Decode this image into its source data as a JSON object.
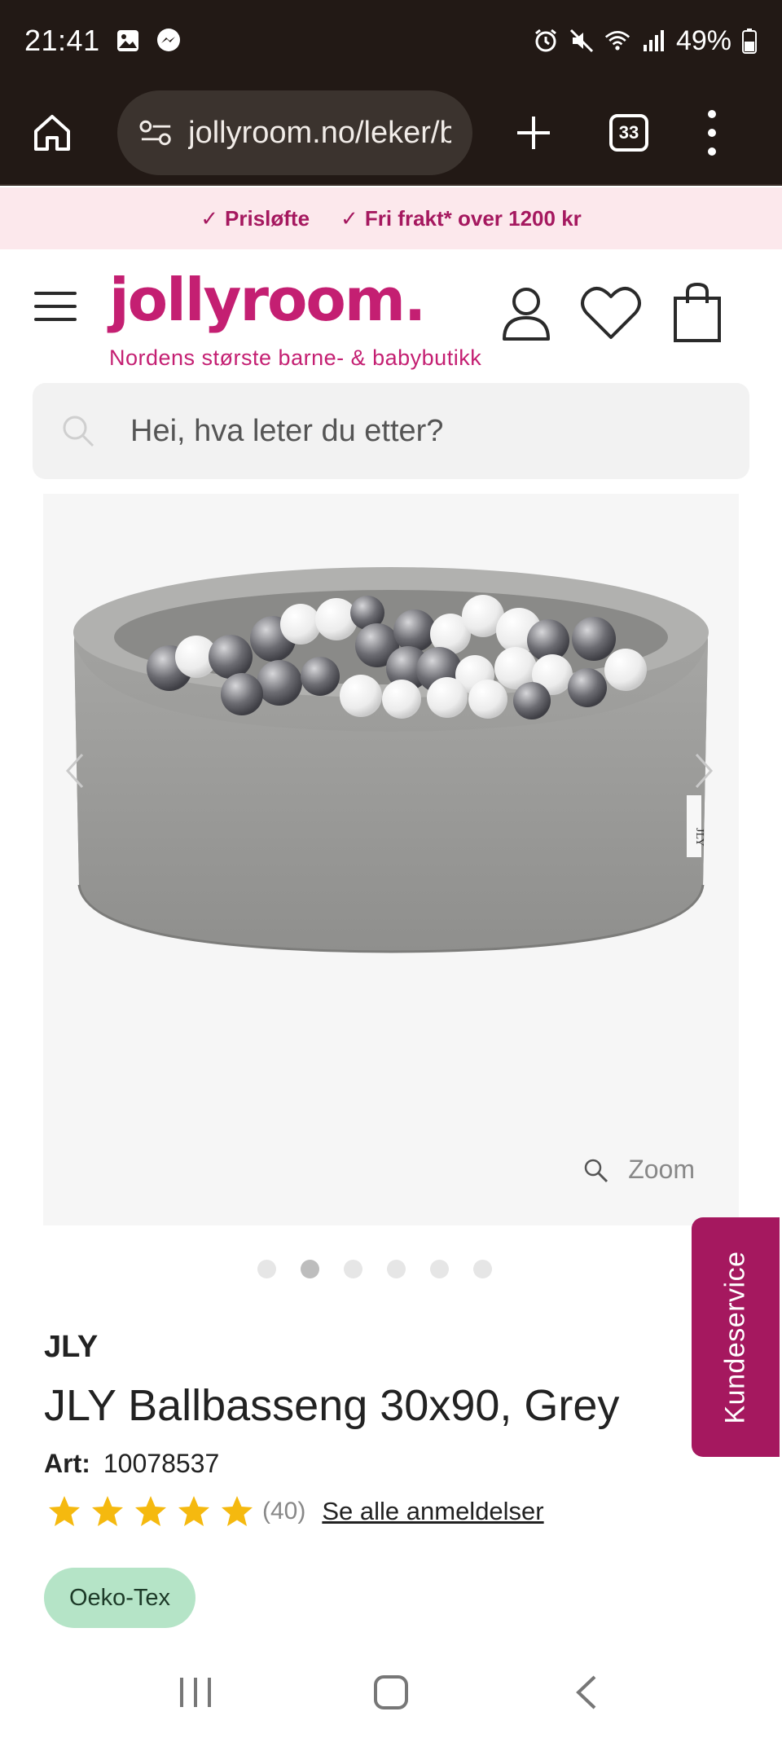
{
  "status_bar": {
    "time": "21:41",
    "battery": "49%",
    "icons": [
      "gallery-icon",
      "messenger-icon",
      "alarm-icon",
      "mute-icon",
      "wifi-icon",
      "signal-icon",
      "battery-icon"
    ]
  },
  "browser": {
    "url": "jollyroom.no/leker/b",
    "tab_count": "33"
  },
  "promo": {
    "items": [
      "Prisløfte",
      "Fri frakt* over 1200 kr"
    ]
  },
  "header": {
    "logo": "jollyroom.",
    "tagline": "Nordens største barne- & babybutikk"
  },
  "search": {
    "placeholder": "Hei, hva leter du etter?"
  },
  "gallery": {
    "zoom_label": "Zoom",
    "slide_count": 6,
    "active_slide": 2
  },
  "kundeservice": "Kundeservice",
  "product": {
    "brand": "JLY",
    "title": "JLY Ballbasseng 30x90, Grey",
    "art_label": "Art:",
    "art_number": "10078537",
    "rating": 5,
    "rating_count": "(40)",
    "reviews_link": "Se alle anmeldelser",
    "badge": "Oeko-Tex"
  },
  "colors": {
    "brand": "#c41f72",
    "kundeservice": "#a5185f",
    "star": "#f5b90f",
    "badge": "#b5e4c7",
    "browser_bg": "#221915"
  }
}
